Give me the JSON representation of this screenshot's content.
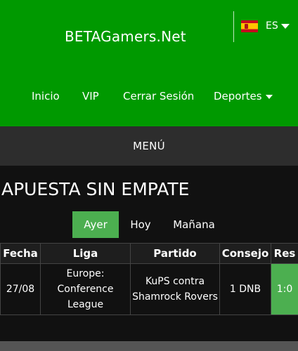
{
  "header": {
    "brand": "BETAGamers.Net",
    "language": {
      "code": "ES",
      "flag_icon": "spain-flag-icon"
    },
    "nav": [
      {
        "label": "Inicio"
      },
      {
        "label": "VIP"
      },
      {
        "label": "Cerrar Sesión"
      },
      {
        "label": "Deportes",
        "has_dropdown": true
      }
    ]
  },
  "menu_label": "MENÚ",
  "page_title": "APUESTA SIN EMPATE",
  "day_tabs": [
    {
      "label": "Ayer",
      "active": true
    },
    {
      "label": "Hoy",
      "active": false
    },
    {
      "label": "Mañana",
      "active": false
    }
  ],
  "table": {
    "columns": [
      "Fecha",
      "Liga",
      "Partido",
      "Consejo",
      "Res"
    ],
    "rows": [
      {
        "fecha": "27/08",
        "liga": "Europe: Conference League",
        "partido": "KuPS contra Shamrock Rovers",
        "consejo": "1 DNB",
        "res": "1:0"
      }
    ]
  },
  "colors": {
    "header_green": "#009900",
    "active_green": "#4caf50",
    "menu_bar": "#2d2d2d",
    "content_bg": "#111111"
  }
}
